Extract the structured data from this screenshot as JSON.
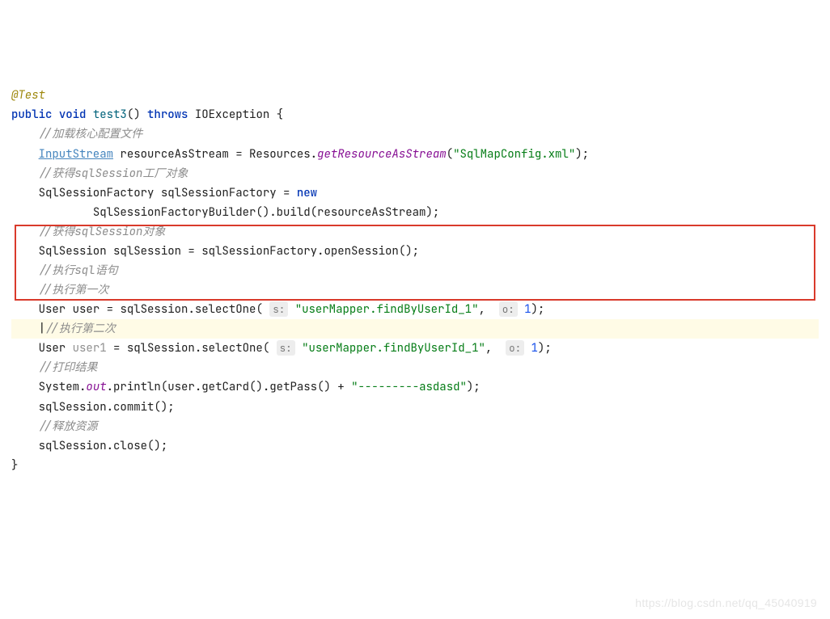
{
  "code": {
    "annotation": "@Test",
    "kw_public": "public",
    "kw_void": "void",
    "method_name": "test3",
    "kw_throws": "throws",
    "exception": "IOException",
    "open_brace": "{",
    "close_brace": "}",
    "c1": "//加载核心配置文件",
    "type_InputStream": "InputStream",
    "var_ras": "resourceAsStream",
    "cls_Resources": "Resources",
    "m_getRAS": "getResourceAsStream",
    "str_config": "\"SqlMapConfig.xml\"",
    "c2": "//获得sqlSession工厂对象",
    "type_SSF": "SqlSessionFactory",
    "var_ssf": "sqlSessionFactory",
    "kw_new": "new",
    "type_SSFB": "SqlSessionFactoryBuilder",
    "m_build": "build",
    "c3": "//获得sqlSession对象",
    "type_SqlSession": "SqlSession",
    "var_sqlSession": "sqlSession",
    "m_openSession": "openSession",
    "c4": "//执行sql语句",
    "c5": "//执行第一次",
    "type_User": "User",
    "var_user": "user",
    "m_selectOne": "selectOne",
    "hint_s": "s:",
    "hint_o": "o:",
    "str_mapper": "\"userMapper.findByUserId_1\"",
    "num_one": "1",
    "c6": "//执行第二次",
    "var_user1": "user1",
    "c7": "//打印结果",
    "cls_System": "System",
    "field_out": "out",
    "m_println": "println",
    "m_getCard": "getCard",
    "m_getPass": "getPass",
    "str_dashes": "\"---------asdasd\"",
    "m_commit": "commit",
    "c8": "//释放资源",
    "m_close": "close",
    "caret": "|"
  },
  "watermark": "https://blog.csdn.net/qq_45040919"
}
